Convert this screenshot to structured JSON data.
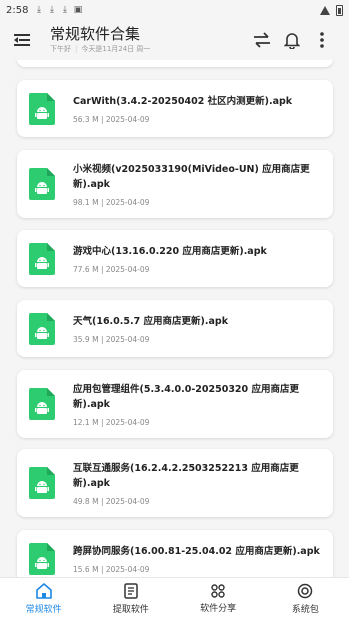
{
  "status": {
    "time": "2:58"
  },
  "header": {
    "title": "常规软件合集",
    "greeting": "下午好",
    "notice": "今天是11月24日 周一"
  },
  "files": [
    {
      "name": "",
      "meta": ""
    },
    {
      "name": "CarWith(3.4.2-20250402 社区内测更新).apk",
      "meta": "56.3 M | 2025-04-09"
    },
    {
      "name": "小米视频(v2025033190(MiVideo-UN) 应用商店更新).apk",
      "meta": "98.1 M | 2025-04-09"
    },
    {
      "name": "游戏中心(13.16.0.220 应用商店更新).apk",
      "meta": "77.6 M | 2025-04-09"
    },
    {
      "name": "天气(16.0.5.7 应用商店更新).apk",
      "meta": "35.9 M | 2025-04-09"
    },
    {
      "name": "应用包管理组件(5.3.4.0.0-20250320 应用商店更新).apk",
      "meta": "12.1 M | 2025-04-09"
    },
    {
      "name": "互联互通服务(16.2.4.2.2503252213 应用商店更新).apk",
      "meta": "49.8 M | 2025-04-09"
    },
    {
      "name": "跨屏协同服务(16.00.81-25.04.02 应用商店更新).apk",
      "meta": "15.6 M | 2025-04-09"
    }
  ],
  "nav": [
    {
      "label": "常规软件"
    },
    {
      "label": "提取软件"
    },
    {
      "label": "软件分享"
    },
    {
      "label": "系统包"
    }
  ],
  "colors": {
    "accent": "#1e88e5",
    "file_icon": "#2ecc71"
  }
}
